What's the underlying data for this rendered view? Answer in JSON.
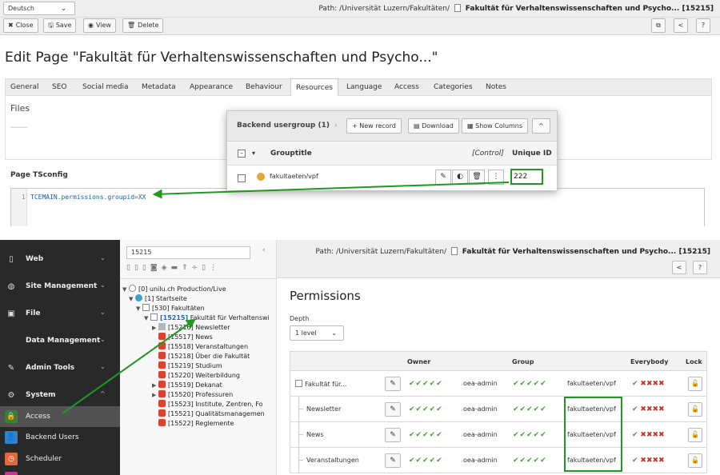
{
  "top": {
    "language": "Deutsch",
    "path_prefix": "Path: /Universität Luzern/Fakultäten/",
    "path_page": "Fakultät für Verhaltenswissenschaften und Psycho... [15215]",
    "buttons": {
      "close": "Close",
      "save": "Save",
      "view": "View",
      "delete": "Delete"
    },
    "edit_title": "Edit Page \"Fakultät für Verhaltenswissenschaften und Psycho...\"",
    "tabs": [
      "General",
      "SEO",
      "Social media",
      "Metadata",
      "Appearance",
      "Behaviour",
      "Resources",
      "Language",
      "Access",
      "Categories",
      "Notes"
    ],
    "active_tab": "Resources",
    "files_label": "Files",
    "tsconfig_label": "Page TSconfig",
    "code_line_no": "1",
    "code_text": "TCEMAIN.permissions.groupid=XX"
  },
  "popup": {
    "title": "Backend usergroup (1)",
    "new_record": "New record",
    "download": "Download",
    "show_columns": "Show Columns",
    "col_grouptitle": "Grouptitle",
    "col_control": "[Control]",
    "col_uid": "Unique ID",
    "row_title": "fakultaeten/vpf",
    "row_uid": "222"
  },
  "sidebar": {
    "modules": [
      {
        "label": "Web"
      },
      {
        "label": "Site Management"
      },
      {
        "label": "File"
      },
      {
        "label": "Data Management"
      },
      {
        "label": "Admin Tools"
      },
      {
        "label": "System"
      },
      {
        "label": "Access"
      },
      {
        "label": "Backend Users"
      },
      {
        "label": "Scheduler"
      }
    ]
  },
  "tree": {
    "search_value": "15215",
    "nodes": [
      "[0] unilu.ch Production/Live",
      "[1] Startseite",
      "[530] Fakultäten",
      "[15215]",
      "Fakultät für Verhaltenswi",
      "[15216] Newsletter",
      "[15517] News",
      "[15518] Veranstaltungen",
      "[15218] Über die Fakultät",
      "[15219] Studium",
      "[15220] Weiterbildung",
      "[15519] Dekanat",
      "[15520] Professuren",
      "[15523] Institute, Zentren, Fo",
      "[15521] Qualitätsmanagemen",
      "[15522] Reglemente"
    ]
  },
  "main": {
    "path_prefix": "Path: /Universität Luzern/Fakultäten/",
    "path_page": "Fakultät für Verhaltenswissenschaften und Psycho... [15215]",
    "title": "Permissions",
    "depth_label": "Depth",
    "depth_value": "1 level",
    "headers": {
      "owner": "Owner",
      "group": "Group",
      "everybody": "Everybody",
      "lock": "Lock"
    },
    "checks": "✔✔✔✔✔",
    "everybody_ok": "✔",
    "everybody_no": "✖✖✖✖",
    "rows": [
      {
        "name": "Fakultät für...",
        "owner": "oea-admin",
        "group": "fakultaeten/vpf"
      },
      {
        "name": "Newsletter",
        "owner": "oea-admin",
        "group": "fakultaeten/vpf"
      },
      {
        "name": "News",
        "owner": "oea-admin",
        "group": "fakultaeten/vpf"
      },
      {
        "name": "Veranstaltungen",
        "owner": "oea-admin",
        "group": "fakultaeten/vpf"
      }
    ]
  },
  "colors": {
    "highlight": "#1f9a1f",
    "check": "#4a9d3b",
    "cross": "#c8342b",
    "sidebar": "#292929"
  }
}
